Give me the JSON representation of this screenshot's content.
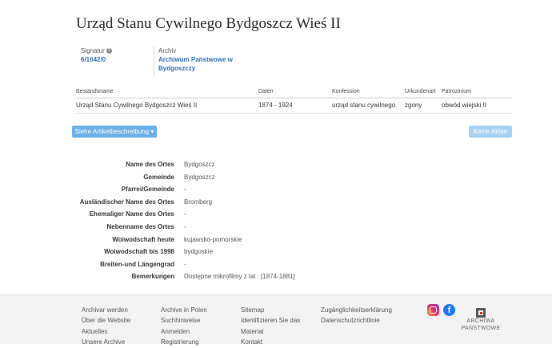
{
  "page": {
    "title": "Urząd Stanu Cywilnego Bydgoszcz Wieś II"
  },
  "meta": {
    "signatur_label": "Signatur",
    "signatur_value": "6/1642/0",
    "archiv_label": "Archiv",
    "archiv_value_line1": "Archiwum Państwowe w",
    "archiv_value_line2": "Bydgoszczy"
  },
  "table": {
    "headers": [
      "Bestandsname",
      "Daten",
      "Konfession",
      "Urkundenart",
      "Patrozinium"
    ],
    "row": [
      "Urząd Stanu Cywilnego Bydgoszcz Wieś II",
      "1874 - 1924",
      "urząd stanu cywilnego",
      "zgony",
      "obwód wiejski II"
    ]
  },
  "buttons": {
    "description": "Siehe Artikelbeschreibung",
    "no_files": "Keine Akten"
  },
  "details": [
    {
      "key": "Name des Ortes",
      "value": "Bydgoszcz"
    },
    {
      "key": "Gemeinde",
      "value": "Bydgoszcz"
    },
    {
      "key": "Pfarrei/Gemeinde",
      "value": "-"
    },
    {
      "key": "Ausländischer Name des Ortes",
      "value": "Bromberg"
    },
    {
      "key": "Ehemaliger Name des Ortes",
      "value": "-"
    },
    {
      "key": "Nebenname des Ortes",
      "value": "-"
    },
    {
      "key": "Woiwodschaft heute",
      "value": "kujawsko-pomorskie"
    },
    {
      "key": "Woiwodschaft bis 1998",
      "value": "bydgoskie"
    },
    {
      "key": "Breiten-und Längengrad",
      "value": "-"
    },
    {
      "key": "Bemerkungen",
      "value": "Dostępne mikrofilmy z lat : [1874-1881]"
    }
  ],
  "footer": {
    "col1": [
      "Archivar werden",
      "Über die Website",
      "Aktuelles",
      "Unsere Archive"
    ],
    "col2": [
      "Archive in Polen",
      "Suchhinweise",
      "Anmelden",
      "Registrierung"
    ],
    "col3": [
      "Sitemap",
      "Identifizieren Sie das",
      "Material",
      "Kontakt"
    ],
    "col4": [
      "Zugänglichkeitserklärung",
      "Datenschutzrichtlinie"
    ],
    "logo_line1": "ARCHIWA",
    "logo_line2": "PAŃSTWOWE",
    "icons": [
      "instagram-icon",
      "facebook-icon"
    ]
  },
  "colors": {
    "accent": "#2a6ebb",
    "button": "#6ab0e8",
    "button_disabled": "#a9d2f2"
  }
}
